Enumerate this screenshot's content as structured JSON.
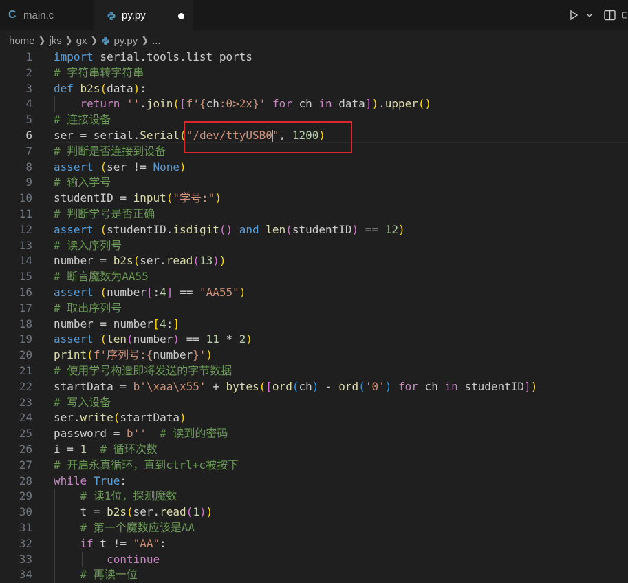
{
  "tabs": [
    {
      "label": "main.c",
      "icon": "c-file-icon"
    },
    {
      "label": "py.py",
      "icon": "python-file-icon",
      "dirty": true
    }
  ],
  "breadcrumb": [
    "home",
    "jks",
    "gx",
    "py.py",
    "..."
  ],
  "editor": {
    "active_line": 6,
    "line_numbers": [
      "1",
      "2",
      "3",
      "4",
      "5",
      "6",
      "7",
      "8",
      "9",
      "10",
      "11",
      "12",
      "13",
      "14",
      "15",
      "16",
      "17",
      "18",
      "19",
      "20",
      "21",
      "22",
      "23",
      "24",
      "25",
      "26",
      "27",
      "28",
      "29",
      "30",
      "31",
      "32",
      "33",
      "34"
    ],
    "lines": [
      [
        [
          "kw",
          "import"
        ],
        [
          "vr",
          " serial.tools.list_ports"
        ]
      ],
      [
        [
          "cm",
          "# 字符串转字符串"
        ]
      ],
      [
        [
          "kw",
          "def"
        ],
        [
          "vr",
          " "
        ],
        [
          "fn",
          "b2s"
        ],
        [
          "b1",
          "("
        ],
        [
          "vr",
          "data"
        ],
        [
          "b1",
          ")"
        ],
        [
          "vr",
          ":"
        ]
      ],
      [
        [
          "vr",
          "    "
        ],
        [
          "cf",
          "return"
        ],
        [
          "vr",
          " "
        ],
        [
          "st",
          "''"
        ],
        [
          "vr",
          "."
        ],
        [
          "fn",
          "join"
        ],
        [
          "b1",
          "("
        ],
        [
          "b2",
          "["
        ],
        [
          "st",
          "f'{"
        ],
        [
          "vr",
          "ch"
        ],
        [
          "st",
          ":0>2x}'"
        ],
        [
          "vr",
          " "
        ],
        [
          "cf",
          "for"
        ],
        [
          "vr",
          " ch "
        ],
        [
          "cf",
          "in"
        ],
        [
          "vr",
          " data"
        ],
        [
          "b2",
          "]"
        ],
        [
          "b1",
          ")"
        ],
        [
          "vr",
          "."
        ],
        [
          "fn",
          "upper"
        ],
        [
          "b1",
          "()"
        ]
      ],
      [
        [
          "cm",
          "# 连接设备"
        ]
      ],
      [
        [
          "vr",
          "ser = serial."
        ],
        [
          "fn",
          "Serial"
        ],
        [
          "b1",
          "("
        ],
        [
          "st",
          "\"/dev/ttyUSB0"
        ],
        [
          "cursor",
          ""
        ],
        [
          "st",
          "\""
        ],
        [
          "vr",
          ", "
        ],
        [
          "nm",
          "1200"
        ],
        [
          "b1",
          ")"
        ]
      ],
      [
        [
          "cm",
          "# 判断是否连接到设备"
        ]
      ],
      [
        [
          "kw",
          "assert"
        ],
        [
          "vr",
          " "
        ],
        [
          "b1",
          "("
        ],
        [
          "vr",
          "ser != "
        ],
        [
          "kw",
          "None"
        ],
        [
          "b1",
          ")"
        ]
      ],
      [
        [
          "cm",
          "# 输入学号"
        ]
      ],
      [
        [
          "vr",
          "studentID = "
        ],
        [
          "fn",
          "input"
        ],
        [
          "b1",
          "("
        ],
        [
          "st",
          "\"学号:\""
        ],
        [
          "b1",
          ")"
        ]
      ],
      [
        [
          "cm",
          "# 判断学号是否正确"
        ]
      ],
      [
        [
          "kw",
          "assert"
        ],
        [
          "vr",
          " "
        ],
        [
          "b1",
          "("
        ],
        [
          "vr",
          "studentID."
        ],
        [
          "fn",
          "isdigit"
        ],
        [
          "b2",
          "()"
        ],
        [
          "vr",
          " "
        ],
        [
          "kw",
          "and"
        ],
        [
          "vr",
          " "
        ],
        [
          "fn",
          "len"
        ],
        [
          "b2",
          "("
        ],
        [
          "vr",
          "studentID"
        ],
        [
          "b2",
          ")"
        ],
        [
          "vr",
          " == "
        ],
        [
          "nm",
          "12"
        ],
        [
          "b1",
          ")"
        ]
      ],
      [
        [
          "cm",
          "# 读入序列号"
        ]
      ],
      [
        [
          "vr",
          "number = "
        ],
        [
          "fn",
          "b2s"
        ],
        [
          "b1",
          "("
        ],
        [
          "vr",
          "ser."
        ],
        [
          "fn",
          "read"
        ],
        [
          "b2",
          "("
        ],
        [
          "nm",
          "13"
        ],
        [
          "b2",
          ")"
        ],
        [
          "b1",
          ")"
        ]
      ],
      [
        [
          "cm",
          "# 断言魔数为AA55"
        ]
      ],
      [
        [
          "kw",
          "assert"
        ],
        [
          "vr",
          " "
        ],
        [
          "b1",
          "("
        ],
        [
          "vr",
          "number"
        ],
        [
          "b2",
          "["
        ],
        [
          "vr",
          ":"
        ],
        [
          "nm",
          "4"
        ],
        [
          "b2",
          "]"
        ],
        [
          "vr",
          " == "
        ],
        [
          "st",
          "\"AA55\""
        ],
        [
          "b1",
          ")"
        ]
      ],
      [
        [
          "cm",
          "# 取出序列号"
        ]
      ],
      [
        [
          "vr",
          "number = number"
        ],
        [
          "b1",
          "["
        ],
        [
          "nm",
          "4"
        ],
        [
          "vr",
          ":"
        ],
        [
          "b1",
          "]"
        ]
      ],
      [
        [
          "kw",
          "assert"
        ],
        [
          "vr",
          " "
        ],
        [
          "b1",
          "("
        ],
        [
          "fn",
          "len"
        ],
        [
          "b2",
          "("
        ],
        [
          "vr",
          "number"
        ],
        [
          "b2",
          ")"
        ],
        [
          "vr",
          " == "
        ],
        [
          "nm",
          "11"
        ],
        [
          "vr",
          " * "
        ],
        [
          "nm",
          "2"
        ],
        [
          "b1",
          ")"
        ]
      ],
      [
        [
          "fn",
          "print"
        ],
        [
          "b1",
          "("
        ],
        [
          "st",
          "f'序列号:{"
        ],
        [
          "vr",
          "number"
        ],
        [
          "st",
          "}'"
        ],
        [
          "b1",
          ")"
        ]
      ],
      [
        [
          "cm",
          "# 使用学号构造即将发送的字节数据"
        ]
      ],
      [
        [
          "vr",
          "startData = "
        ],
        [
          "st",
          "b'\\xaa\\x55'"
        ],
        [
          "vr",
          " + "
        ],
        [
          "fn",
          "bytes"
        ],
        [
          "b1",
          "("
        ],
        [
          "b2",
          "["
        ],
        [
          "fn",
          "ord"
        ],
        [
          "b3",
          "("
        ],
        [
          "vr",
          "ch"
        ],
        [
          "b3",
          ")"
        ],
        [
          "vr",
          " - "
        ],
        [
          "fn",
          "ord"
        ],
        [
          "b3",
          "("
        ],
        [
          "st",
          "'0'"
        ],
        [
          "b3",
          ")"
        ],
        [
          "vr",
          " "
        ],
        [
          "cf",
          "for"
        ],
        [
          "vr",
          " ch "
        ],
        [
          "cf",
          "in"
        ],
        [
          "vr",
          " studentID"
        ],
        [
          "b2",
          "]"
        ],
        [
          "b1",
          ")"
        ]
      ],
      [
        [
          "cm",
          "# 写入设备"
        ]
      ],
      [
        [
          "vr",
          "ser."
        ],
        [
          "fn",
          "write"
        ],
        [
          "b1",
          "("
        ],
        [
          "vr",
          "startData"
        ],
        [
          "b1",
          ")"
        ]
      ],
      [
        [
          "vr",
          "password = "
        ],
        [
          "st",
          "b''"
        ],
        [
          "vr",
          "  "
        ],
        [
          "cm",
          "# 读到的密码"
        ]
      ],
      [
        [
          "vr",
          "i = "
        ],
        [
          "nm",
          "1"
        ],
        [
          "vr",
          "  "
        ],
        [
          "cm",
          "# 循环次数"
        ]
      ],
      [
        [
          "cm",
          "# 开启永真循环，直到ctrl+c被按下"
        ]
      ],
      [
        [
          "cf",
          "while"
        ],
        [
          "vr",
          " "
        ],
        [
          "kw",
          "True"
        ],
        [
          "vr",
          ":"
        ]
      ],
      [
        [
          "vr",
          "    "
        ],
        [
          "cm",
          "# 读1位，探测魔数"
        ]
      ],
      [
        [
          "vr",
          "    t = "
        ],
        [
          "fn",
          "b2s"
        ],
        [
          "b1",
          "("
        ],
        [
          "vr",
          "ser."
        ],
        [
          "fn",
          "read"
        ],
        [
          "b2",
          "("
        ],
        [
          "nm",
          "1"
        ],
        [
          "b2",
          ")"
        ],
        [
          "b1",
          ")"
        ]
      ],
      [
        [
          "vr",
          "    "
        ],
        [
          "cm",
          "# 第一个魔数应该是AA"
        ]
      ],
      [
        [
          "vr",
          "    "
        ],
        [
          "cf",
          "if"
        ],
        [
          "vr",
          " t != "
        ],
        [
          "st",
          "\"AA\""
        ],
        [
          "vr",
          ":"
        ]
      ],
      [
        [
          "vr",
          "        "
        ],
        [
          "cf",
          "continue"
        ]
      ],
      [
        [
          "vr",
          "    "
        ],
        [
          "cm",
          "# 再读一位"
        ]
      ]
    ]
  }
}
